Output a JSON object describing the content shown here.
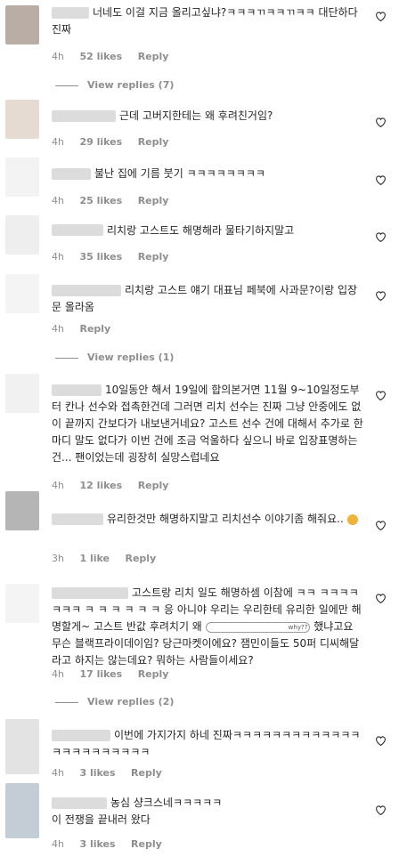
{
  "comments": [
    {
      "text": "너네도 이걸 지금 올리고싶냐?ㅋㅋㅋㄲㅋㅋㄲㅋㅋ 대단하다 진짜",
      "time": "4h",
      "likes": "52 likes",
      "reply": "Reply",
      "view_replies": "View replies (7)"
    },
    {
      "text": "근데 고버지한테는 왜 후려친거임?",
      "time": "4h",
      "likes": "29 likes",
      "reply": "Reply"
    },
    {
      "text": "불난 집에 기름 붓기 ㅋㅋㅋㅋㅋㅋㅋㅋ",
      "time": "4h",
      "likes": "25 likes",
      "reply": "Reply"
    },
    {
      "text": "리치랑 고스트도 해명해라 물타기하지말고",
      "time": "4h",
      "likes": "35 likes",
      "reply": "Reply"
    },
    {
      "text": "리치랑 고스트 얘기 대표님 페북에 사과문?이랑 입장문 올라옴",
      "time": "4h",
      "reply": "Reply",
      "view_replies": "View replies (1)"
    },
    {
      "text": "10일동안 해서 19일에 합의본거면 11월 9~10일정도부터 칸나 선수와 접촉한건데 그러면 리치 선수는 진짜 그냥 안중에도 없이 끝까지 간보다가 내보낸거네요? 고스트 선수 건에 대해서 추가로 한 마디 말도 없다가 이번 건에 조금 억울하다 싶으니 바로 입장표명하는건... 팬이었는데 굉장히 실망스럽네요",
      "time": "4h",
      "likes": "12 likes",
      "reply": "Reply"
    },
    {
      "text": "유리한것만 해명하지말고 리치선수 이야기좀 해줘요..",
      "time": "3h",
      "likes": "1 like",
      "reply": "Reply"
    },
    {
      "text": "고스트랑 리치 일도 해명하셈 이참에 ㅋㅋ ㅋㅋㅋㅋㅋㅋㅋ ㅋ ㅋ ㅋ ㅋ ㅋ ㅋ 응 아니야 우리는 우리한테 유리한 일에만 해명할게~ 고스트 반값 후려치기 왜",
      "text2": "했냐고요 무슨 블랙프라이데이임? 당근마켓이에요? 잼민이들도 50퍼 디씨해달라고 하지는 않는데요? 뭐하는 사람들이세요?",
      "sticker": "why??",
      "time": "4h",
      "likes": "17 likes",
      "reply": "Reply",
      "view_replies": "View replies (2)"
    },
    {
      "text": "이번에 가지가지 하네 진짜ㅋㅋㅋㅋㅋㅋㅋㅋㅋㅋㅋㅋㅋㅋㅋㅋㅋㅋㅋㅋㅋㅋㅋ",
      "time": "4h",
      "likes": "3 likes",
      "reply": "Reply"
    },
    {
      "text": "농심 샹크스네ㅋㅋㅋㅋㅋ",
      "text2": "이 전쟁을 끝내러 왔다",
      "time": "4h",
      "likes": "3 likes",
      "reply": "Reply"
    }
  ],
  "icons": {
    "like": "heart-outline-icon"
  },
  "colors": {
    "text": "#262626",
    "meta": "#8e8e8e"
  }
}
